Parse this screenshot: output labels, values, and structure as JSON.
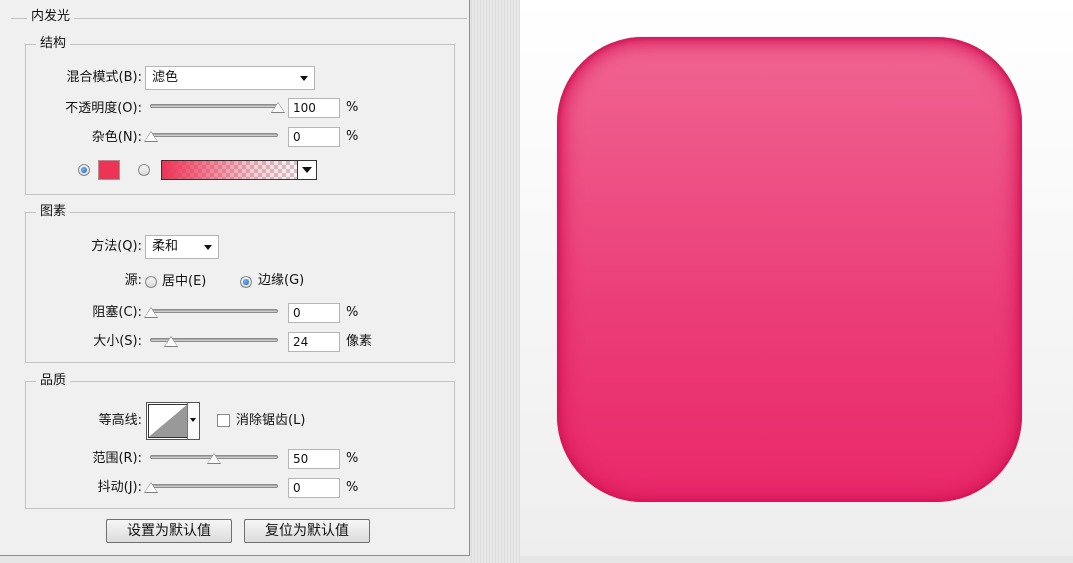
{
  "dialog": {
    "section_title": "内发光",
    "structure": {
      "title": "结构",
      "blend_mode": {
        "label": "混合模式(B):",
        "value": "滤色"
      },
      "opacity": {
        "label": "不透明度(O):",
        "value": "100",
        "unit": "%",
        "fraction": 1.0
      },
      "noise": {
        "label": "杂色(N):",
        "value": "0",
        "unit": "%",
        "fraction": 0.0
      },
      "color_swatch": "#ee3355",
      "gradient_color": "#ee3355"
    },
    "elements": {
      "title": "图素",
      "technique": {
        "label": "方法(Q):",
        "value": "柔和"
      },
      "source": {
        "label": "源:",
        "center_label": "居中(E)",
        "edge_label": "边缘(G)",
        "selected": "edge"
      },
      "choke": {
        "label": "阻塞(C):",
        "value": "0",
        "unit": "%",
        "fraction": 0.0
      },
      "size": {
        "label": "大小(S):",
        "value": "24",
        "unit": "像素",
        "fraction": 0.1
      }
    },
    "quality": {
      "title": "品质",
      "contour": {
        "label": "等高线:"
      },
      "anti_alias": {
        "label": "消除锯齿(L)",
        "checked": false
      },
      "range": {
        "label": "范围(R):",
        "value": "50",
        "unit": "%",
        "fraction": 0.5
      },
      "jitter": {
        "label": "抖动(J):",
        "value": "0",
        "unit": "%",
        "fraction": 0.0
      }
    },
    "buttons": {
      "make_default": "设置为默认值",
      "reset_default": "复位为默认值"
    }
  },
  "preview": {
    "tile_color": "#eb3c77"
  }
}
